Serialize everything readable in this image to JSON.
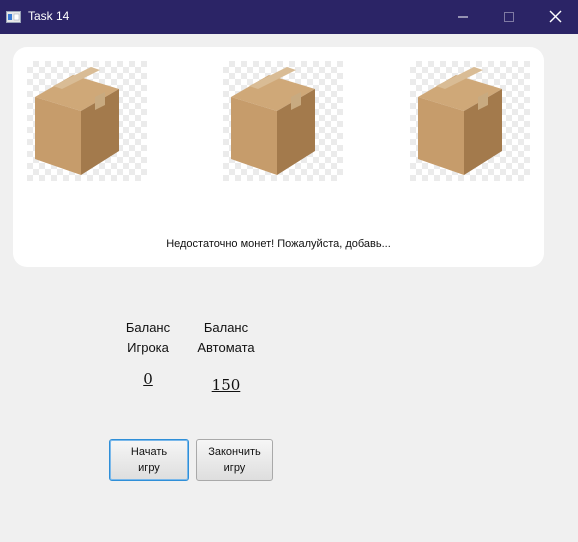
{
  "window": {
    "title": "Task 14",
    "controls": [
      "minimize-icon",
      "maximize-icon",
      "close-icon"
    ]
  },
  "slots": {
    "items": [
      {
        "icon": "cardboard-box-icon"
      },
      {
        "icon": "cardboard-box-icon"
      },
      {
        "icon": "cardboard-box-icon"
      }
    ],
    "status_message": "Недостаточно монет! Пожалуйста, добавь..."
  },
  "balances": {
    "player_label_1": "Баланс",
    "player_label_2": "Игрока",
    "player_value": "0",
    "machine_label_1": "Баланс",
    "machine_label_2": "Автомата",
    "machine_value": "150"
  },
  "buttons": {
    "start_label": "Начать\nигру",
    "end_label": "Закончить\nигру"
  },
  "colors": {
    "titlebar": "#2b2466",
    "card": "#ffffff",
    "background": "#f0f0f0",
    "focus_border": "#2f8fd8"
  }
}
